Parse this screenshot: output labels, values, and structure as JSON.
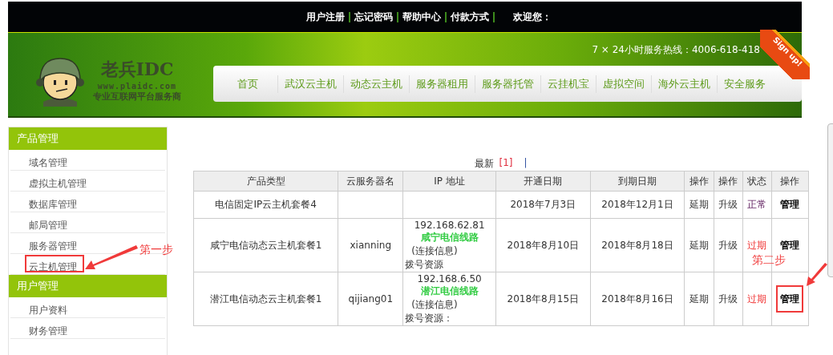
{
  "top_bar": {
    "links": [
      "用户注册",
      "忘记密码",
      "帮助中心",
      "付款方式"
    ],
    "welcome": "欢迎您："
  },
  "banner": {
    "logo_title": "老兵IDC",
    "logo_url": "www.plaidc.com",
    "logo_slogan": "专业互联网平台服务商",
    "hotline": "7 × 24小时服务热线：4006-618-418",
    "ribbon": "Sign up!",
    "nav": [
      "首页",
      "武汉云主机",
      "动态云主机",
      "服务器租用",
      "服务器托管",
      "云挂机宝",
      "虚拟空间",
      "海外云主机",
      "安全服务"
    ]
  },
  "sidebar": {
    "sections": [
      {
        "title": "产品管理",
        "items": [
          {
            "label": "域名管理",
            "highlighted": false
          },
          {
            "label": "虚拟主机管理",
            "highlighted": false
          },
          {
            "label": "数据库管理",
            "highlighted": false
          },
          {
            "label": "邮局管理",
            "highlighted": false
          },
          {
            "label": "服务器管理",
            "highlighted": false
          },
          {
            "label": "云主机管理",
            "highlighted": true
          }
        ]
      },
      {
        "title": "用户管理",
        "items": [
          {
            "label": "用户资料",
            "highlighted": false
          },
          {
            "label": "财务管理",
            "highlighted": false
          }
        ]
      }
    ]
  },
  "pager": {
    "label": "最新",
    "page": "[1]",
    "separator": "|"
  },
  "table": {
    "columns": [
      "产品类型",
      "云服务器名",
      "IP 地址",
      "开通日期",
      "到期日期",
      "操作",
      "操作",
      "状态",
      "操作"
    ],
    "rows": [
      {
        "product": "电信固定IP云主机套餐4",
        "open": "2018年7月3日",
        "expire": "2018年12月1日",
        "extend": "延期",
        "upgrade": "升级",
        "status": "正常",
        "expired": false,
        "manage": "管理",
        "highlighted": false
      },
      {
        "product": "咸宁电信动态云主机套餐1",
        "server": "xianning",
        "ip": "192.168.62.81",
        "line": "咸宁电信线路",
        "conn_label": "(连接信息)",
        "dial_label": "拨号资源",
        "open": "2018年8月10日",
        "expire": "2018年8月18日",
        "extend": "延期",
        "upgrade": "升级",
        "status": "过期",
        "expired": true,
        "manage": "管理",
        "highlighted": false
      },
      {
        "product": "潜江电信动态云主机套餐1",
        "server": "qijiang01",
        "ip": "192.168.6.50",
        "line": "潜江电信线路",
        "conn_label": "(连接信息)",
        "dial_label": "拨号资源：",
        "open": "2018年8月15日",
        "expire": "2018年8月16日",
        "extend": "延期",
        "upgrade": "升级",
        "status": "过期",
        "expired": true,
        "manage": "管理",
        "highlighted": true
      }
    ]
  },
  "annotations": [
    "第一步",
    "第二步"
  ]
}
